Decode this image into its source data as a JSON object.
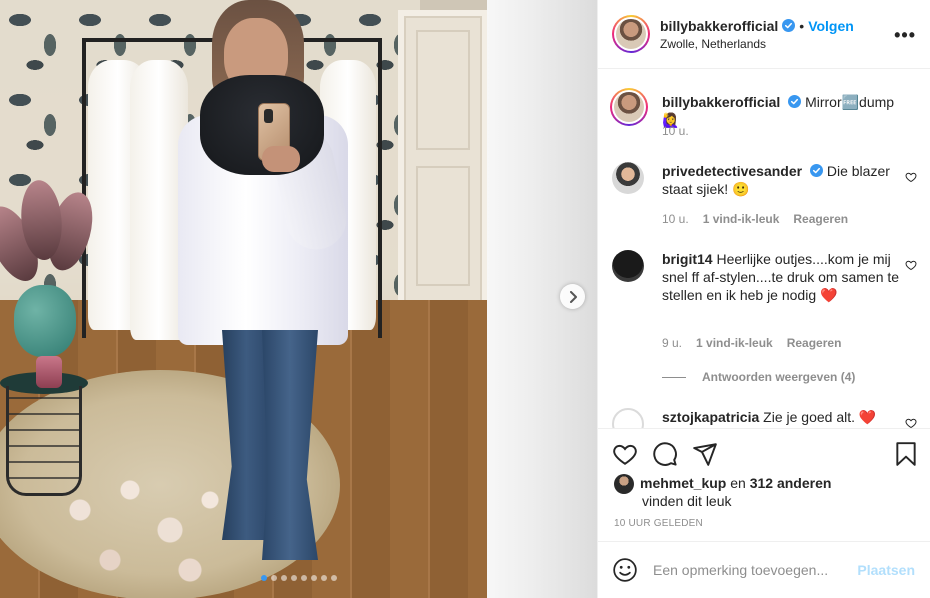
{
  "post": {
    "username": "billybakkerofficial",
    "verified": true,
    "follow_label": "Volgen",
    "separator": "•",
    "location": "Zwolle, Netherlands",
    "more_icon": "more-options-icon",
    "more_label": "•••"
  },
  "carousel": {
    "total_slides": 8,
    "active_slide": 1,
    "next_icon": "chevron-right-icon"
  },
  "caption": {
    "username": "billybakkerofficial",
    "text": "Mirror🆓dump🙋‍♀️",
    "time": "10 u."
  },
  "comments": [
    {
      "username": "privedetectivesander",
      "verified": true,
      "text": "Die blazer staat sjiek! 🙂",
      "time": "10 u.",
      "likes": "1 vind-ik-leuk",
      "reply_label": "Reageren"
    },
    {
      "username": "brigit14",
      "verified": false,
      "text": "Heerlijke outjes....kom je mij snel ff af-stylen....te druk om samen te stellen en ik heb je nodig ❤️",
      "time": "9 u.",
      "likes": "1 vind-ik-leuk",
      "reply_label": "Reageren",
      "view_replies": "Antwoorden weergeven (4)"
    },
    {
      "username": "sztojkapatricia",
      "verified": false,
      "text": "Zie je goed alt. ❤️"
    }
  ],
  "actions": {
    "like_icon": "heart-icon",
    "comment_icon": "comment-icon",
    "share_icon": "share-icon",
    "save_icon": "bookmark-icon"
  },
  "likes": {
    "first_user": "mehmet_kup",
    "connector": " en ",
    "others": "312 anderen",
    "suffix": "vinden dit leuk"
  },
  "timestamp": "10 UUR GELEDEN",
  "add_comment": {
    "placeholder": "Een opmerking toevoegen...",
    "post_label": "Plaatsen",
    "emoji_icon": "emoji-icon"
  },
  "colors": {
    "accent": "#0095f6",
    "post_disabled": "#b2dffc",
    "muted": "#8e8e8e",
    "heart_red": "#ed4956"
  }
}
